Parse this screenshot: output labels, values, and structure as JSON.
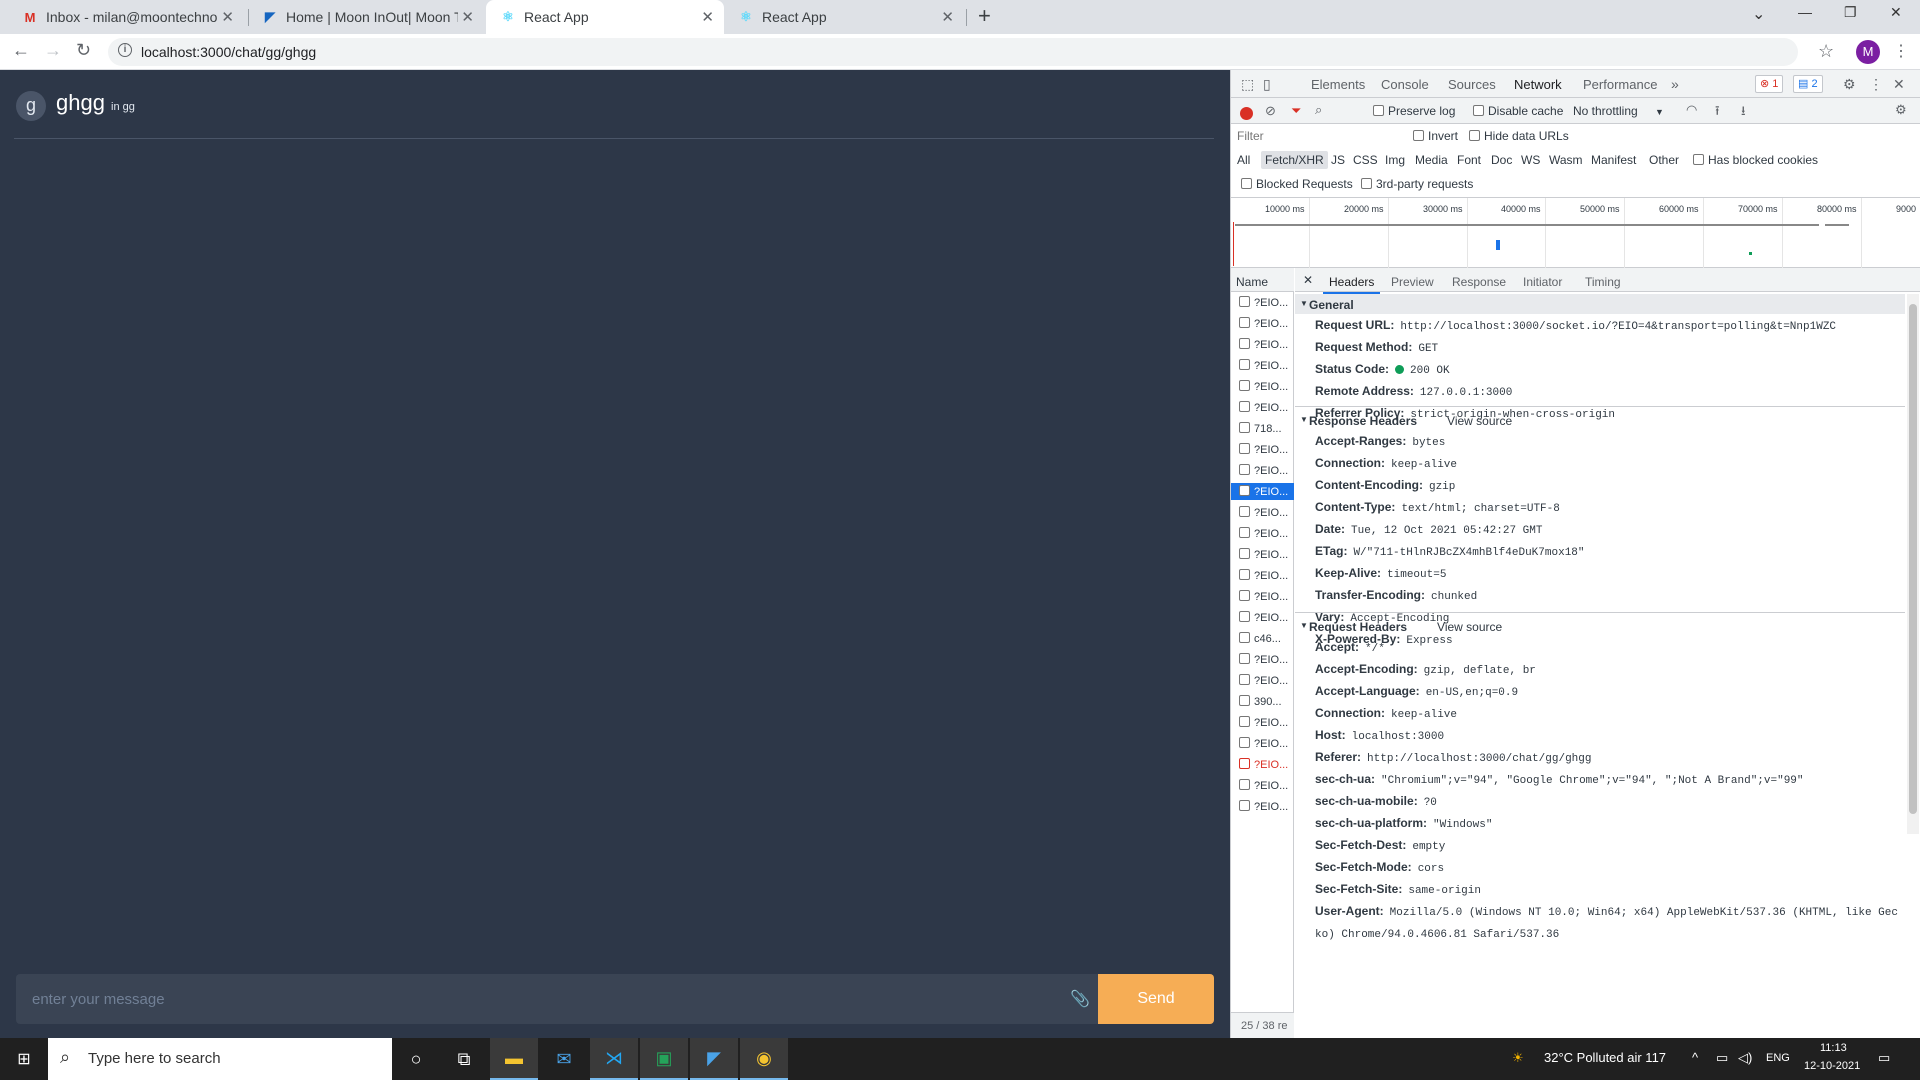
{
  "browser": {
    "tabs": [
      {
        "title": "Inbox - milan@moontechnolabs.c",
        "favicon": "gmail-icon"
      },
      {
        "title": "Home | Moon InOut| Moon Tech",
        "favicon": "moon-inout-icon"
      },
      {
        "title": "React App",
        "favicon": "react-icon"
      },
      {
        "title": "React App",
        "favicon": "react-icon"
      }
    ],
    "url": "localhost:3000/chat/gg/ghgg",
    "profile_initial": "M"
  },
  "app": {
    "avatar_letter": "g",
    "chat_name": "ghgg",
    "chat_subtitle": "in gg",
    "message_placeholder": "enter your message",
    "send_label": "Send"
  },
  "devtools": {
    "tabs": [
      "Elements",
      "Console",
      "Sources",
      "Network",
      "Performance"
    ],
    "error_count": "1",
    "message_count": "2",
    "preserve_log": "Preserve log",
    "disable_cache": "Disable cache",
    "throttling": "No throttling",
    "filter_placeholder": "Filter",
    "invert": "Invert",
    "hide_data_urls": "Hide data URLs",
    "filter_types": [
      "All",
      "Fetch/XHR",
      "JS",
      "CSS",
      "Img",
      "Media",
      "Font",
      "Doc",
      "WS",
      "Wasm",
      "Manifest",
      "Other"
    ],
    "has_blocked_cookies": "Has blocked cookies",
    "blocked_requests": "Blocked Requests",
    "third_party": "3rd-party requests",
    "ticks": [
      "10000 ms",
      "20000 ms",
      "30000 ms",
      "40000 ms",
      "50000 ms",
      "60000 ms",
      "70000 ms",
      "80000 ms",
      "9000"
    ],
    "name_header": "Name",
    "requests": [
      "?EIO...",
      "?EIO...",
      "?EIO...",
      "?EIO...",
      "?EIO...",
      "?EIO...",
      "718...",
      "?EIO...",
      "?EIO...",
      "?EIO...",
      "?EIO...",
      "?EIO...",
      "?EIO...",
      "?EIO...",
      "?EIO...",
      "?EIO...",
      "c46...",
      "?EIO...",
      "?EIO...",
      "390...",
      "?EIO...",
      "?EIO...",
      "?EIO...",
      "?EIO...",
      "?EIO..."
    ],
    "footer": "25 / 38 re",
    "detail_tabs": [
      "Headers",
      "Preview",
      "Response",
      "Initiator",
      "Timing"
    ],
    "general_title": "General",
    "general": [
      {
        "k": "Request URL:",
        "v": "http://localhost:3000/socket.io/?EIO=4&transport=polling&t=Nnp1WZC"
      },
      {
        "k": "Request Method:",
        "v": "GET"
      },
      {
        "k": "Status Code:",
        "v": "200 OK"
      },
      {
        "k": "Remote Address:",
        "v": "127.0.0.1:3000"
      },
      {
        "k": "Referrer Policy:",
        "v": "strict-origin-when-cross-origin"
      }
    ],
    "response_title": "Response Headers",
    "view_source": "View source",
    "response": [
      {
        "k": "Accept-Ranges:",
        "v": "bytes"
      },
      {
        "k": "Connection:",
        "v": "keep-alive"
      },
      {
        "k": "Content-Encoding:",
        "v": "gzip"
      },
      {
        "k": "Content-Type:",
        "v": "text/html; charset=UTF-8"
      },
      {
        "k": "Date:",
        "v": "Tue, 12 Oct 2021 05:42:27 GMT"
      },
      {
        "k": "ETag:",
        "v": "W/\"711-tHlnRJBcZX4mhBlf4eDuK7mox18\""
      },
      {
        "k": "Keep-Alive:",
        "v": "timeout=5"
      },
      {
        "k": "Transfer-Encoding:",
        "v": "chunked"
      },
      {
        "k": "Vary:",
        "v": "Accept-Encoding"
      },
      {
        "k": "X-Powered-By:",
        "v": "Express"
      }
    ],
    "request_title": "Request Headers",
    "request": [
      {
        "k": "Accept:",
        "v": "*/*"
      },
      {
        "k": "Accept-Encoding:",
        "v": "gzip, deflate, br"
      },
      {
        "k": "Accept-Language:",
        "v": "en-US,en;q=0.9"
      },
      {
        "k": "Connection:",
        "v": "keep-alive"
      },
      {
        "k": "Host:",
        "v": "localhost:3000"
      },
      {
        "k": "Referer:",
        "v": "http://localhost:3000/chat/gg/ghgg"
      },
      {
        "k": "sec-ch-ua:",
        "v": "\"Chromium\";v=\"94\", \"Google Chrome\";v=\"94\", \";Not A Brand\";v=\"99\""
      },
      {
        "k": "sec-ch-ua-mobile:",
        "v": "?0"
      },
      {
        "k": "sec-ch-ua-platform:",
        "v": "\"Windows\""
      },
      {
        "k": "Sec-Fetch-Dest:",
        "v": "empty"
      },
      {
        "k": "Sec-Fetch-Mode:",
        "v": "cors"
      },
      {
        "k": "Sec-Fetch-Site:",
        "v": "same-origin"
      },
      {
        "k": "User-Agent:",
        "v": "Mozilla/5.0 (Windows NT 10.0; Win64; x64) AppleWebKit/537.36 (KHTML, like Gec"
      },
      {
        "k": "",
        "v": "ko) Chrome/94.0.4606.81 Safari/537.36"
      }
    ]
  },
  "taskbar": {
    "search_placeholder": "Type here to search",
    "weather": "32°C  Polluted air 117",
    "lang": "ENG",
    "time": "11:13",
    "date": "12-10-2021"
  }
}
